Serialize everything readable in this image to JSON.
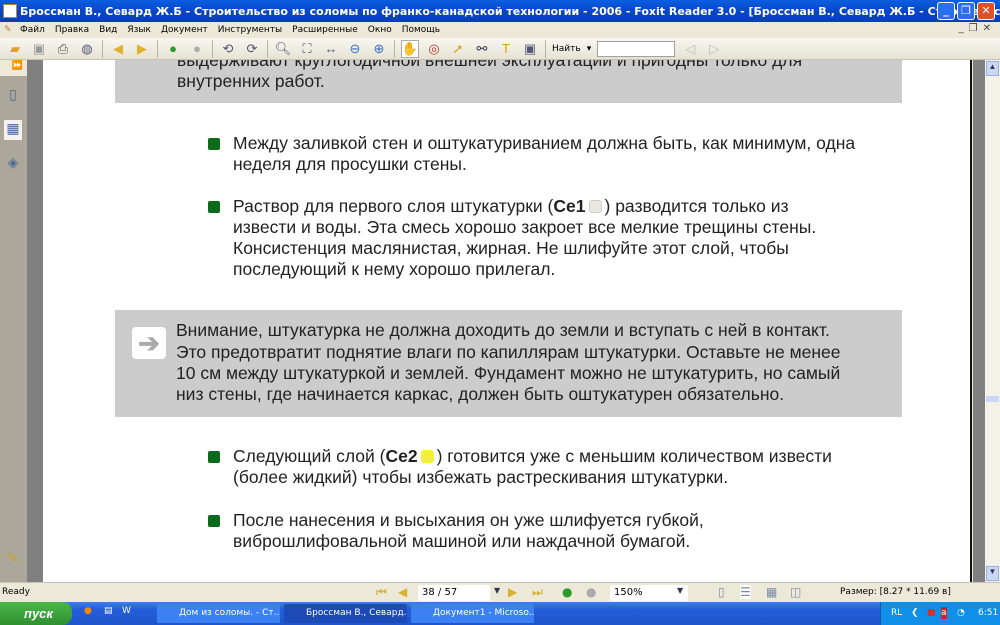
{
  "window": {
    "title": "Броссман В., Севард Ж.Б - Строительство из соломы по франко-канадской технологии - 2006 - Foxit Reader 3.0 - [Броссман В., Севард Ж.Б - Строительство из солом]",
    "minimize": "_",
    "restore": "❐",
    "close": "✕"
  },
  "menu": [
    "Файл",
    "Правка",
    "Вид",
    "Язык",
    "Документ",
    "Инструменты",
    "Расширенные",
    "Окно",
    "Помощь"
  ],
  "toolbar": {
    "find_label": "Найть",
    "find_value": ""
  },
  "page": {
    "top_box_lines": [
      "выдерживают круглогодичной внешней эксплуатации и пригодны только для",
      "внутренних работ."
    ],
    "bullet1": [
      "Между заливкой стен и оштукатуриванием должна быть, как минимум, одна",
      "неделя для просушки стены."
    ],
    "bullet2": {
      "pre": "Раствор для первого слоя штукатурки (",
      "bold": "Се1",
      "post": ") разводится только из",
      "lines": [
        "извести и воды. Эта смесь хорошо закроет все мелкие трещины стены.",
        "Консистенция маслянистая, жирная. Не шлифуйте этот слой, чтобы",
        "последующий к нему хорошо прилегал."
      ],
      "swatch": "#e8e8e0"
    },
    "callout": [
      "Внимание, штукатурка не должна доходить до земли и вступать с ней в контакт.",
      "Это предотвратит поднятие влаги по капиллярам штукатурки. Оставьте не менее",
      "10 см между штукатуркой и землей. Фундамент можно не штукатурить, но самый",
      "низ стены, где начинается каркас, должен быть оштукатурен обязательно."
    ],
    "bullet3": {
      "pre": "Следующий слой (",
      "bold": "Се2",
      "post": ") готовится уже с меньшим количеством извести",
      "lines": [
        "(более жидкий) чтобы избежать растрескивания штукатурки."
      ],
      "swatch": "#f5ee3a"
    },
    "bullet4": [
      "После нанесения и высыхания он уже шлифуется губкой,",
      "виброшлифовальной машиной или наждачной бумагой."
    ],
    "bullet_color": "#0b6b1a"
  },
  "status": {
    "ready": "Ready",
    "page": "38 / 57",
    "zoom": "150%",
    "size": "Размер: [8.27 * 11.69 в]"
  },
  "taskbar": {
    "start": "пуск",
    "tasks": [
      "Дом из соломы. - Ст...",
      "Броссман В., Севард...",
      "Документ1 - Microso..."
    ],
    "lang": "RL",
    "clock": "6:51"
  }
}
